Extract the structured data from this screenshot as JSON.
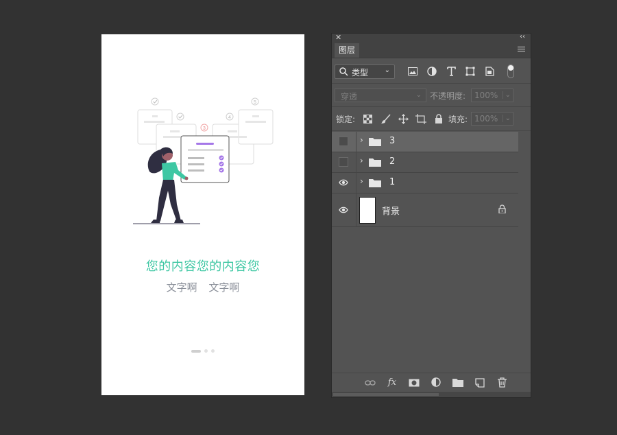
{
  "canvas": {
    "headline": "您的内容您的内容您",
    "sub_texts": [
      "文字啊",
      "文字啊"
    ],
    "step_numbers": [
      "3",
      "4",
      "5"
    ],
    "pagination": {
      "total": 3,
      "active": 1
    },
    "accent_color": "#3ec7a3"
  },
  "panel": {
    "close_glyph": "✕",
    "collapse_glyph": "‹‹",
    "tab_label": "图层",
    "filter": {
      "kind_label": "类型",
      "icons": [
        "image-filter-icon",
        "adjustment-filter-icon",
        "type-filter-icon",
        "shape-filter-icon",
        "smart-object-filter-icon"
      ]
    },
    "blend_mode": "穿透",
    "opacity_label": "不透明度:",
    "opacity_value": "100%",
    "lock_label": "锁定:",
    "fill_label": "填充:",
    "fill_value": "100%",
    "layers": [
      {
        "name": "3",
        "type": "group",
        "visible": false,
        "selected": true
      },
      {
        "name": "2",
        "type": "group",
        "visible": false,
        "selected": false
      },
      {
        "name": "1",
        "type": "group",
        "visible": true,
        "selected": false
      },
      {
        "name": "背景",
        "type": "background",
        "visible": true,
        "locked": true
      }
    ],
    "bottom_tools": [
      "link-layers-icon",
      "fx-icon",
      "add-mask-icon",
      "adjustment-layer-icon",
      "new-group-icon",
      "new-layer-icon",
      "delete-layer-icon"
    ],
    "fx_label": "fx"
  }
}
